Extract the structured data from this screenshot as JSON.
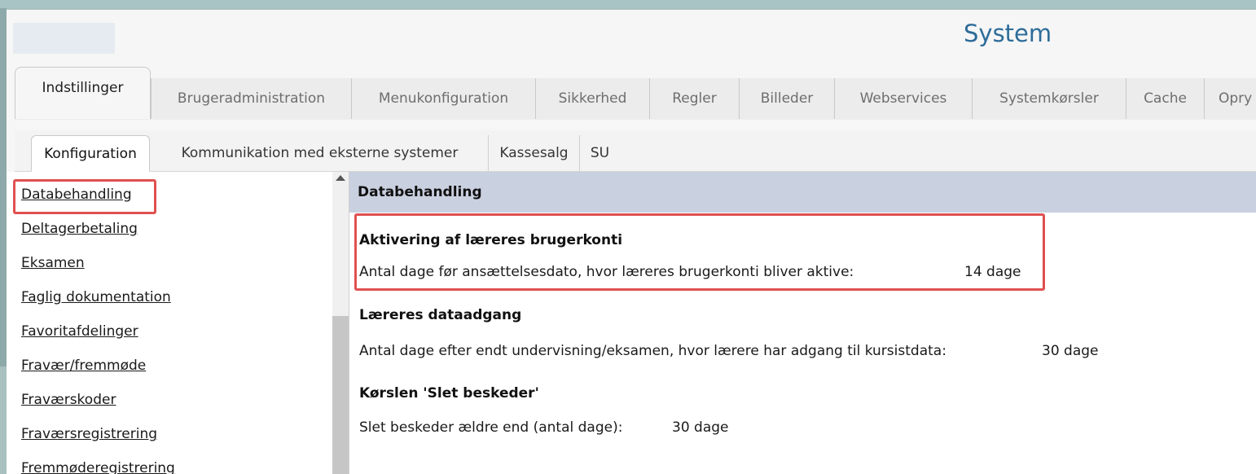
{
  "header": {
    "title": "System"
  },
  "main_tabs": [
    {
      "label": "Indstillinger",
      "active": true
    },
    {
      "label": "Brugeradministration"
    },
    {
      "label": "Menukonfiguration"
    },
    {
      "label": "Sikkerhed"
    },
    {
      "label": "Regler"
    },
    {
      "label": "Billeder"
    },
    {
      "label": "Webservices"
    },
    {
      "label": "Systemkørsler"
    },
    {
      "label": "Cache"
    },
    {
      "label": "Opry"
    }
  ],
  "sub_tabs": [
    {
      "label": "Konfiguration",
      "active": true
    },
    {
      "label": "Kommunikation med eksterne systemer"
    },
    {
      "label": "Kassesalg"
    },
    {
      "label": "SU"
    }
  ],
  "sidebar": {
    "items": [
      {
        "label": "Databehandling",
        "selected": true
      },
      {
        "label": "Deltagerbetaling"
      },
      {
        "label": "Eksamen"
      },
      {
        "label": "Faglig dokumentation"
      },
      {
        "label": "Favoritafdelinger"
      },
      {
        "label": "Fravær/fremmøde"
      },
      {
        "label": "Fraværskoder"
      },
      {
        "label": "Fraværsregistrering"
      },
      {
        "label": "Fremmøderegistrering"
      }
    ]
  },
  "content": {
    "header": "Databehandling",
    "sections": [
      {
        "title": "Aktivering af læreres brugerkonti",
        "label": "Antal dage før ansættelsesdato, hvor læreres brugerkonti bliver aktive:",
        "value": "14 dage"
      },
      {
        "title": "Læreres dataadgang",
        "label": "Antal dage efter endt undervisning/eksamen, hvor lærere har adgang til kursistdata:",
        "value": "30 dage"
      },
      {
        "title": "Kørslen 'Slet beskeder'",
        "label": "Slet beskeder ældre end (antal dage):",
        "value": "30 dage"
      }
    ]
  },
  "colors": {
    "title": "#2d6c99",
    "content_header_bg": "#c9d0e0",
    "highlight": "#e05050"
  }
}
